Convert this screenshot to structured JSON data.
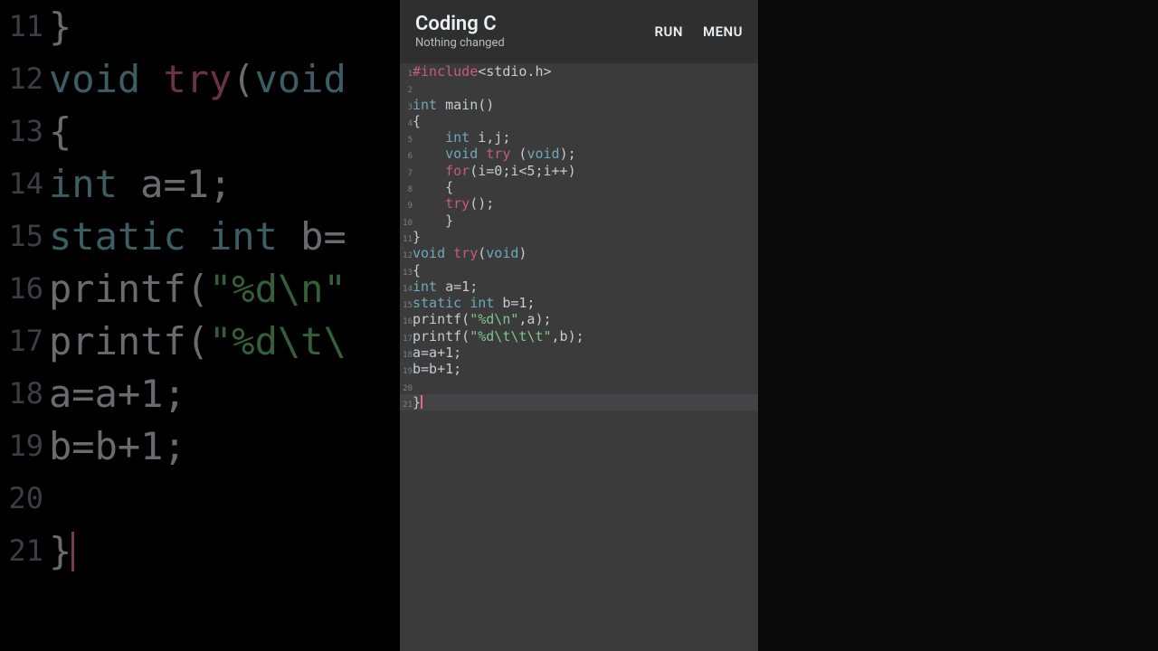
{
  "header": {
    "title": "Coding C",
    "subtitle": "Nothing changed",
    "run": "RUN",
    "menu": "MENU"
  },
  "bg_lines": [
    {
      "n": "11",
      "tokens": [
        {
          "t": "}",
          "c": "tok-d"
        }
      ]
    },
    {
      "n": "12",
      "tokens": [
        {
          "t": "void ",
          "c": "tok-k"
        },
        {
          "t": "try",
          "c": "tok-f"
        },
        {
          "t": "(",
          "c": "tok-d"
        },
        {
          "t": "void",
          "c": "tok-k"
        }
      ]
    },
    {
      "n": "13",
      "tokens": [
        {
          "t": "{",
          "c": "tok-d"
        }
      ]
    },
    {
      "n": "14",
      "tokens": [
        {
          "t": "int ",
          "c": "tok-k"
        },
        {
          "t": "a=1;",
          "c": "tok-d"
        }
      ]
    },
    {
      "n": "15",
      "tokens": [
        {
          "t": "static ",
          "c": "tok-k"
        },
        {
          "t": "int ",
          "c": "tok-k"
        },
        {
          "t": "b=",
          "c": "tok-d"
        }
      ]
    },
    {
      "n": "16",
      "tokens": [
        {
          "t": "printf(",
          "c": "tok-d"
        },
        {
          "t": "\"%d\\n\"",
          "c": "tok-s"
        }
      ]
    },
    {
      "n": "17",
      "tokens": [
        {
          "t": "printf(",
          "c": "tok-d"
        },
        {
          "t": "\"%d\\t\\",
          "c": "tok-s"
        }
      ]
    },
    {
      "n": "18",
      "tokens": [
        {
          "t": "a=a+1;",
          "c": "tok-d"
        }
      ]
    },
    {
      "n": "19",
      "tokens": [
        {
          "t": "b=b+1;",
          "c": "tok-d"
        }
      ]
    },
    {
      "n": "20",
      "tokens": []
    },
    {
      "n": "21",
      "tokens": [
        {
          "t": "}",
          "c": "tok-d"
        },
        {
          "t": "",
          "c": "cursor"
        }
      ]
    }
  ],
  "code_lines": [
    {
      "n": "1",
      "tokens": [
        {
          "t": "#include",
          "c": "tok-include"
        },
        {
          "t": "<stdio.h>",
          "c": "tok-angle"
        }
      ]
    },
    {
      "n": "2",
      "tokens": []
    },
    {
      "n": "3",
      "tokens": [
        {
          "t": "int ",
          "c": "tok-type"
        },
        {
          "t": "main()",
          "c": "tok-def"
        }
      ]
    },
    {
      "n": "4",
      "tokens": [
        {
          "t": "{",
          "c": "tok-def"
        }
      ]
    },
    {
      "n": "5",
      "tokens": [
        {
          "t": "    ",
          "c": "tok-def"
        },
        {
          "t": "int ",
          "c": "tok-type"
        },
        {
          "t": "i,j;",
          "c": "tok-def"
        }
      ]
    },
    {
      "n": "6",
      "tokens": [
        {
          "t": "    ",
          "c": "tok-def"
        },
        {
          "t": "void ",
          "c": "tok-type"
        },
        {
          "t": "try ",
          "c": "tok-kw"
        },
        {
          "t": "(",
          "c": "tok-def"
        },
        {
          "t": "void",
          "c": "tok-type"
        },
        {
          "t": ");",
          "c": "tok-def"
        }
      ]
    },
    {
      "n": "7",
      "tokens": [
        {
          "t": "    ",
          "c": "tok-def"
        },
        {
          "t": "for",
          "c": "tok-kw"
        },
        {
          "t": "(i=0;i<5;i++)",
          "c": "tok-def"
        }
      ]
    },
    {
      "n": "8",
      "tokens": [
        {
          "t": "    {",
          "c": "tok-def"
        }
      ]
    },
    {
      "n": "9",
      "tokens": [
        {
          "t": "    ",
          "c": "tok-def"
        },
        {
          "t": "try",
          "c": "tok-kw"
        },
        {
          "t": "();",
          "c": "tok-def"
        }
      ]
    },
    {
      "n": "10",
      "tokens": [
        {
          "t": "    }",
          "c": "tok-def"
        }
      ]
    },
    {
      "n": "11",
      "tokens": [
        {
          "t": "}",
          "c": "tok-def"
        }
      ]
    },
    {
      "n": "12",
      "tokens": [
        {
          "t": "void ",
          "c": "tok-type"
        },
        {
          "t": "try",
          "c": "tok-kw"
        },
        {
          "t": "(",
          "c": "tok-def"
        },
        {
          "t": "void",
          "c": "tok-type"
        },
        {
          "t": ")",
          "c": "tok-def"
        }
      ]
    },
    {
      "n": "13",
      "tokens": [
        {
          "t": "{",
          "c": "tok-def"
        }
      ]
    },
    {
      "n": "14",
      "tokens": [
        {
          "t": "int ",
          "c": "tok-type"
        },
        {
          "t": "a=1;",
          "c": "tok-def"
        }
      ]
    },
    {
      "n": "15",
      "tokens": [
        {
          "t": "static ",
          "c": "tok-type"
        },
        {
          "t": "int ",
          "c": "tok-type"
        },
        {
          "t": "b=1;",
          "c": "tok-def"
        }
      ]
    },
    {
      "n": "16",
      "tokens": [
        {
          "t": "printf(",
          "c": "tok-def"
        },
        {
          "t": "\"%d\\n\"",
          "c": "tok-str"
        },
        {
          "t": ",a);",
          "c": "tok-def"
        }
      ]
    },
    {
      "n": "17",
      "tokens": [
        {
          "t": "printf(",
          "c": "tok-def"
        },
        {
          "t": "\"%d\\t\\t\\t\"",
          "c": "tok-str"
        },
        {
          "t": ",b);",
          "c": "tok-def"
        }
      ]
    },
    {
      "n": "18",
      "tokens": [
        {
          "t": "a=a+1;",
          "c": "tok-def"
        }
      ]
    },
    {
      "n": "19",
      "tokens": [
        {
          "t": "b=b+1;",
          "c": "tok-def"
        }
      ]
    },
    {
      "n": "20",
      "tokens": []
    },
    {
      "n": "21",
      "hl": true,
      "tokens": [
        {
          "t": "}",
          "c": "tok-def"
        },
        {
          "t": "",
          "c": "phc"
        }
      ]
    }
  ]
}
